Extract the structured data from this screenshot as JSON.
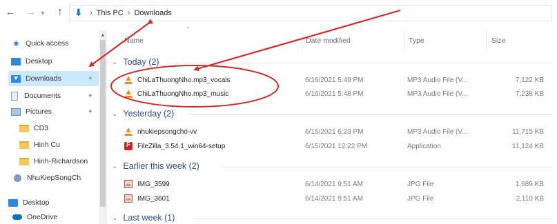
{
  "address_bar": {
    "path": [
      "This PC",
      "Downloads"
    ]
  },
  "sidebar": {
    "items": [
      {
        "label": "Quick access",
        "icon": "star-icon"
      },
      {
        "label": "Desktop",
        "icon": "desktop-icon"
      },
      {
        "label": "Downloads",
        "icon": "download-icon",
        "selected": true
      },
      {
        "label": "Documents",
        "icon": "document-icon"
      },
      {
        "label": "Pictures",
        "icon": "pictures-icon"
      },
      {
        "label": "CD3",
        "icon": "folder-icon"
      },
      {
        "label": "Hinh Cu",
        "icon": "folder-icon"
      },
      {
        "label": "Hinh-Richardson",
        "icon": "folder-icon"
      },
      {
        "label": "NhuKiepSongCh",
        "icon": "globe-icon"
      },
      {
        "label": "Desktop",
        "icon": "desktop-icon"
      },
      {
        "label": "OneDrive",
        "icon": "cloud-icon"
      }
    ]
  },
  "columns": {
    "name": "Name",
    "date_modified": "Date modified",
    "type": "Type",
    "size": "Size"
  },
  "groups": [
    {
      "label": "Today (2)",
      "files": [
        {
          "name": "ChiLaThuongNho.mp3_vocals",
          "date": "6/16/2021 5:49 PM",
          "type": "MP3 Audio File (V...",
          "size": "7,122 KB",
          "icon": "vlc-icon"
        },
        {
          "name": "ChiLaThuongNho.mp3_music",
          "date": "6/16/2021 5:48 PM",
          "type": "MP3 Audio File (V...",
          "size": "7,238 KB",
          "icon": "vlc-icon"
        }
      ]
    },
    {
      "label": "Yesterday (2)",
      "files": [
        {
          "name": "nhukiepsongcho-vv",
          "date": "6/15/2021 6:23 PM",
          "type": "MP3 Audio File (V...",
          "size": "11,715 KB",
          "icon": "vlc-icon"
        },
        {
          "name": "FileZilla_3.54.1_win64-setup",
          "date": "6/15/2021 12:22 PM",
          "type": "Application",
          "size": "11,124 KB",
          "icon": "filezilla-icon"
        }
      ]
    },
    {
      "label": "Earlier this week (2)",
      "files": [
        {
          "name": "IMG_3599",
          "date": "6/14/2021 9:51 AM",
          "type": "JPG File",
          "size": "1,689 KB",
          "icon": "image-icon"
        },
        {
          "name": "IMG_3601",
          "date": "6/14/2021 9:51 AM",
          "type": "JPG File",
          "size": "2,110 KB",
          "icon": "image-icon"
        }
      ]
    },
    {
      "label": "Last week (1)",
      "files": []
    }
  ],
  "colors": {
    "selection": "#cce8ff",
    "group_text": "#2f4f8f",
    "annotation": "#d9262b"
  }
}
